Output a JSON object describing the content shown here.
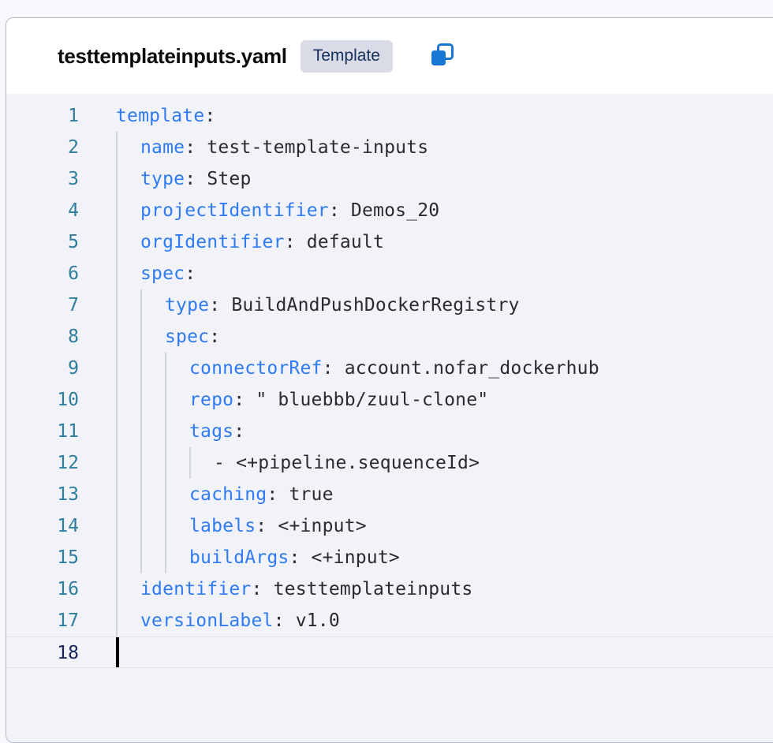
{
  "card": {
    "header": {
      "file_title": "testtemplateinputs.yaml",
      "badge_label": "Template",
      "copy_icon": "copy-icon"
    }
  },
  "editor": {
    "language": "yaml",
    "active_line": 18,
    "total_lines": 18,
    "lines": [
      {
        "no": "1",
        "indent": 0,
        "key": "template",
        "sep": ":",
        "value": ""
      },
      {
        "no": "2",
        "indent": 1,
        "key": "name",
        "sep": ": ",
        "value": "test-template-inputs"
      },
      {
        "no": "3",
        "indent": 1,
        "key": "type",
        "sep": ": ",
        "value": "Step"
      },
      {
        "no": "4",
        "indent": 1,
        "key": "projectIdentifier",
        "sep": ": ",
        "value": "Demos_20"
      },
      {
        "no": "5",
        "indent": 1,
        "key": "orgIdentifier",
        "sep": ": ",
        "value": "default"
      },
      {
        "no": "6",
        "indent": 1,
        "key": "spec",
        "sep": ":",
        "value": ""
      },
      {
        "no": "7",
        "indent": 2,
        "key": "type",
        "sep": ": ",
        "value": "BuildAndPushDockerRegistry"
      },
      {
        "no": "8",
        "indent": 2,
        "key": "spec",
        "sep": ":",
        "value": ""
      },
      {
        "no": "9",
        "indent": 3,
        "key": "connectorRef",
        "sep": ": ",
        "value": "account.nofar_dockerhub"
      },
      {
        "no": "10",
        "indent": 3,
        "key": "repo",
        "sep": ": ",
        "value": "\" bluebbb/zuul-clone\""
      },
      {
        "no": "11",
        "indent": 3,
        "key": "tags",
        "sep": ":",
        "value": ""
      },
      {
        "no": "12",
        "indent": 4,
        "key": "",
        "sep": "",
        "value": "- <+pipeline.sequenceId>"
      },
      {
        "no": "13",
        "indent": 3,
        "key": "caching",
        "sep": ": ",
        "value": "true"
      },
      {
        "no": "14",
        "indent": 3,
        "key": "labels",
        "sep": ": ",
        "value": "<+input>"
      },
      {
        "no": "15",
        "indent": 3,
        "key": "buildArgs",
        "sep": ": ",
        "value": "<+input>"
      },
      {
        "no": "16",
        "indent": 1,
        "key": "identifier",
        "sep": ": ",
        "value": "testtemplateinputs"
      },
      {
        "no": "17",
        "indent": 1,
        "key": "versionLabel",
        "sep": ": ",
        "value": "v1.0"
      },
      {
        "no": "18",
        "indent": 0,
        "key": "",
        "sep": "",
        "value": ""
      }
    ],
    "indent_guides": [
      {
        "level": 1,
        "from_line": 2,
        "to_line": 17
      },
      {
        "level": 2,
        "from_line": 7,
        "to_line": 15
      },
      {
        "level": 3,
        "from_line": 9,
        "to_line": 15
      },
      {
        "level": 4,
        "from_line": 12,
        "to_line": 12
      }
    ]
  },
  "colors": {
    "page_background": "#f7f8fc",
    "card_background": "#ffffff",
    "card_border": "#b5b7c8",
    "editor_background": "#f1f3f8",
    "key_color": "#2f7af5",
    "value_color": "#2b2b2f",
    "line_number_color": "#2f7d9c",
    "active_line_number_color": "#1b2660",
    "badge_background": "#d9dbe7",
    "badge_text": "#16305c",
    "accent": "#1976d2",
    "indent_guide": "#d2d4dc",
    "caret": "#000000"
  }
}
